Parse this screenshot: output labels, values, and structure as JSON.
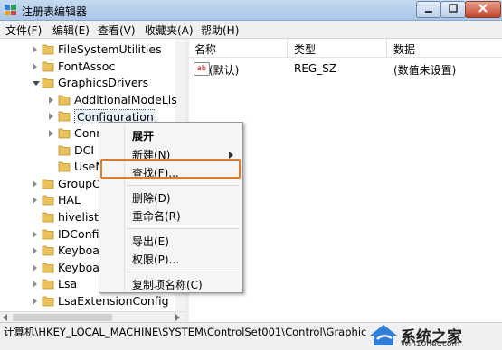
{
  "window": {
    "title": "注册表编辑器"
  },
  "menubar": [
    "文件(F)",
    "编辑(E)",
    "查看(V)",
    "收藏夹(A)",
    "帮助(H)"
  ],
  "tree": {
    "items": [
      {
        "label": "FileSystemUtilities",
        "depth": 1,
        "expander": "collapsed"
      },
      {
        "label": "FontAssoc",
        "depth": 1,
        "expander": "collapsed"
      },
      {
        "label": "GraphicsDrivers",
        "depth": 1,
        "expander": "expanded"
      },
      {
        "label": "AdditionalModeLis",
        "depth": 2,
        "expander": "collapsed"
      },
      {
        "label": "Configuration",
        "depth": 2,
        "expander": "collapsed",
        "selected": true
      },
      {
        "label": "Conn",
        "depth": 2,
        "expander": "collapsed"
      },
      {
        "label": "DCI",
        "depth": 2,
        "expander": "none"
      },
      {
        "label": "UseN",
        "depth": 2,
        "expander": "none"
      },
      {
        "label": "GroupOr",
        "depth": 1,
        "expander": "collapsed"
      },
      {
        "label": "HAL",
        "depth": 1,
        "expander": "collapsed"
      },
      {
        "label": "hivelist",
        "depth": 1,
        "expander": "none"
      },
      {
        "label": "IDConfig",
        "depth": 1,
        "expander": "collapsed"
      },
      {
        "label": "Keyboar",
        "depth": 1,
        "expander": "collapsed"
      },
      {
        "label": "Keyboar",
        "depth": 1,
        "expander": "collapsed"
      },
      {
        "label": "Lsa",
        "depth": 1,
        "expander": "collapsed"
      },
      {
        "label": "LsaExtensionConfig",
        "depth": 1,
        "expander": "collapsed"
      }
    ]
  },
  "list": {
    "columns": [
      "名称",
      "类型",
      "数据"
    ],
    "rows": [
      {
        "icon": "ab",
        "name": "(默认)",
        "type": "REG_SZ",
        "data": "(数值未设置)"
      }
    ]
  },
  "context_menu": {
    "items": [
      {
        "label": "展开",
        "bold": true
      },
      {
        "label": "新建(N)",
        "submenu": true
      },
      {
        "label": "查找(F)...",
        "highlighted": true
      },
      {
        "separator": true
      },
      {
        "label": "删除(D)"
      },
      {
        "label": "重命名(R)"
      },
      {
        "separator": true
      },
      {
        "label": "导出(E)"
      },
      {
        "label": "权限(P)..."
      },
      {
        "separator": true
      },
      {
        "label": "复制项名称(C)"
      }
    ]
  },
  "statusbar": {
    "path": "计算机\\HKEY_LOCAL_MACHINE\\SYSTEM\\ControlSet001\\Control\\Graphic"
  },
  "watermark": {
    "text": "系统之家",
    "url": "Win10net.com"
  },
  "colors": {
    "highlight_box": "#e07a2d",
    "titlebar": "#b8d0ec",
    "folder": "#e8c25a"
  }
}
